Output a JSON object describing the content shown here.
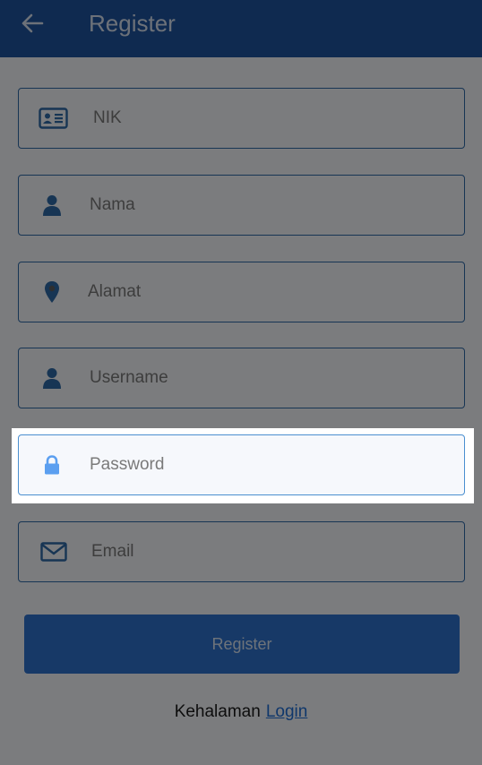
{
  "header": {
    "title": "Register"
  },
  "form": {
    "nik_placeholder": "NIK",
    "nama_placeholder": "Nama",
    "alamat_placeholder": "Alamat",
    "username_placeholder": "Username",
    "password_placeholder": "Password",
    "email_placeholder": "Email",
    "submit_label": "Register"
  },
  "footer": {
    "text": "Kehalaman",
    "link": "Login"
  },
  "colors": {
    "primary": "#1e55a0",
    "button": "#2f72cf",
    "link": "#1f6fd6"
  }
}
